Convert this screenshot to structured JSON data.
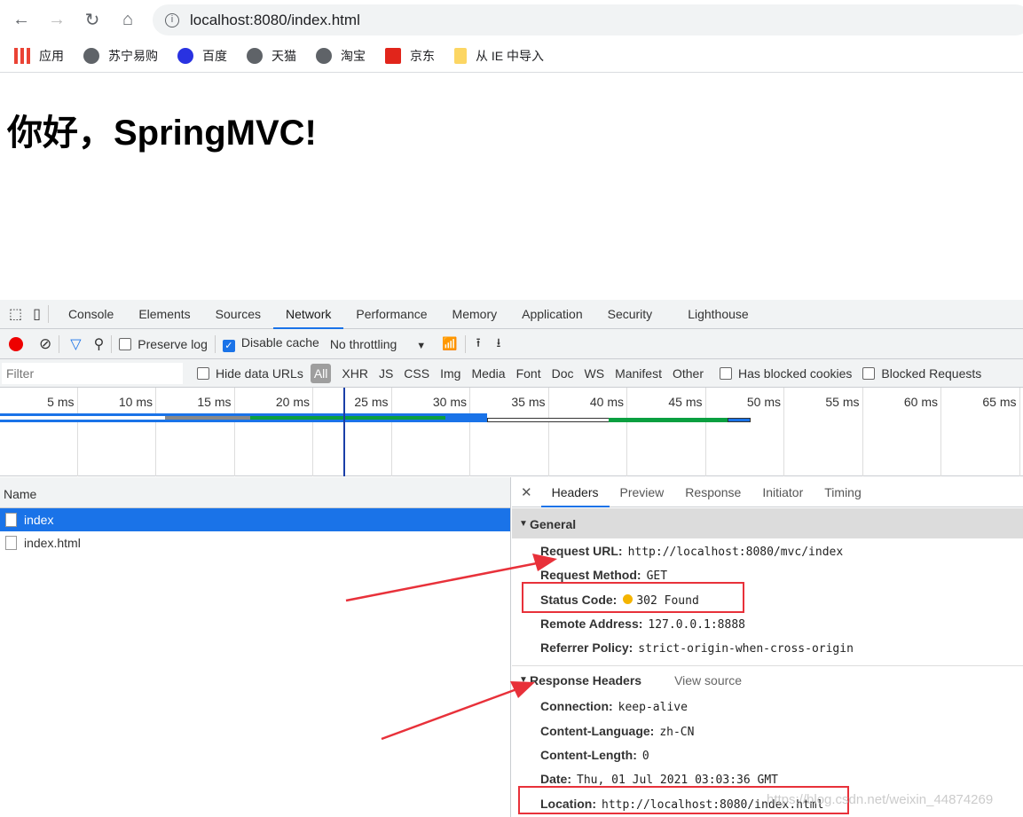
{
  "browser": {
    "url": "localhost:8080/index.html",
    "bookmarks": [
      "应用",
      "苏宁易购",
      "百度",
      "天猫",
      "淘宝",
      "京东",
      "从 IE 中导入"
    ]
  },
  "page": {
    "heading": "你好，SpringMVC!"
  },
  "devtools": {
    "tabs": [
      "Console",
      "Elements",
      "Sources",
      "Network",
      "Performance",
      "Memory",
      "Application",
      "Security",
      "Lighthouse"
    ],
    "active_tab": "Network",
    "toolbar": {
      "preserve_log": "Preserve log",
      "preserve_log_checked": false,
      "disable_cache": "Disable cache",
      "disable_cache_checked": true,
      "throttling": "No throttling"
    },
    "filter": {
      "placeholder": "Filter",
      "hide_data_urls": "Hide data URLs",
      "types": [
        "All",
        "XHR",
        "JS",
        "CSS",
        "Img",
        "Media",
        "Font",
        "Doc",
        "WS",
        "Manifest",
        "Other"
      ],
      "has_blocked_cookies": "Has blocked cookies",
      "blocked_requests": "Blocked Requests"
    },
    "timeline_ticks": [
      "5 ms",
      "10 ms",
      "15 ms",
      "20 ms",
      "25 ms",
      "30 ms",
      "35 ms",
      "40 ms",
      "45 ms",
      "50 ms",
      "55 ms",
      "60 ms",
      "65 ms"
    ],
    "requests": {
      "header": "Name",
      "items": [
        "index",
        "index.html"
      ],
      "selected": "index"
    },
    "detail": {
      "tabs": [
        "Headers",
        "Preview",
        "Response",
        "Initiator",
        "Timing"
      ],
      "general_title": "General",
      "general": [
        {
          "k": "Request URL:",
          "v": "http://localhost:8080/mvc/index"
        },
        {
          "k": "Request Method:",
          "v": "GET"
        },
        {
          "k": "Status Code:",
          "v": "302 Found"
        },
        {
          "k": "Remote Address:",
          "v": "127.0.0.1:8888"
        },
        {
          "k": "Referrer Policy:",
          "v": "strict-origin-when-cross-origin"
        }
      ],
      "response_title": "Response Headers",
      "view_source": "View source",
      "response": [
        {
          "k": "Connection:",
          "v": "keep-alive"
        },
        {
          "k": "Content-Language:",
          "v": "zh-CN"
        },
        {
          "k": "Content-Length:",
          "v": "0"
        },
        {
          "k": "Date:",
          "v": "Thu, 01 Jul 2021 03:03:36 GMT"
        },
        {
          "k": "Location:",
          "v": "http://localhost:8080/index.html"
        }
      ]
    }
  },
  "watermark": "https://blog.csdn.net/weixin_44874269"
}
